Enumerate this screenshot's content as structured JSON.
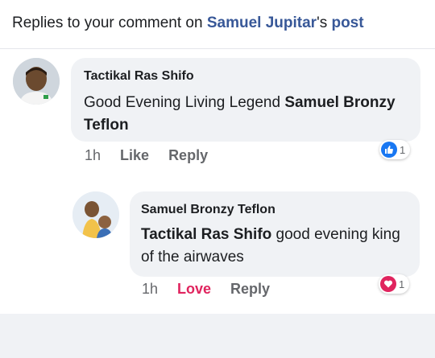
{
  "header": {
    "prefix": "Replies to your comment on ",
    "owner": "Samuel Jupitar",
    "possessive": "'s ",
    "post": "post"
  },
  "comment": {
    "author": "Tactikal Ras Shifo",
    "text_plain": "Good Evening Living Legend ",
    "text_bold": "Samuel Bronzy Teflon",
    "time": "1h",
    "like_label": "Like",
    "reply_label": "Reply",
    "reaction_count": "1",
    "reaction_icon": "like-icon",
    "reaction_color": "#1877f2"
  },
  "reply": {
    "author": "Samuel Bronzy Teflon",
    "text_bold": "Tactikal Ras Shifo",
    "text_plain": " good evening king of the airwaves",
    "time": "1h",
    "love_label": "Love",
    "reply_label": "Reply",
    "reaction_count": "1",
    "reaction_icon": "love-icon",
    "reaction_color": "#e0245e"
  },
  "colors": {
    "link_blue": "#385898",
    "bubble_bg": "#f0f2f5",
    "meta_gray": "#65676b",
    "love_red": "#e0245e"
  }
}
